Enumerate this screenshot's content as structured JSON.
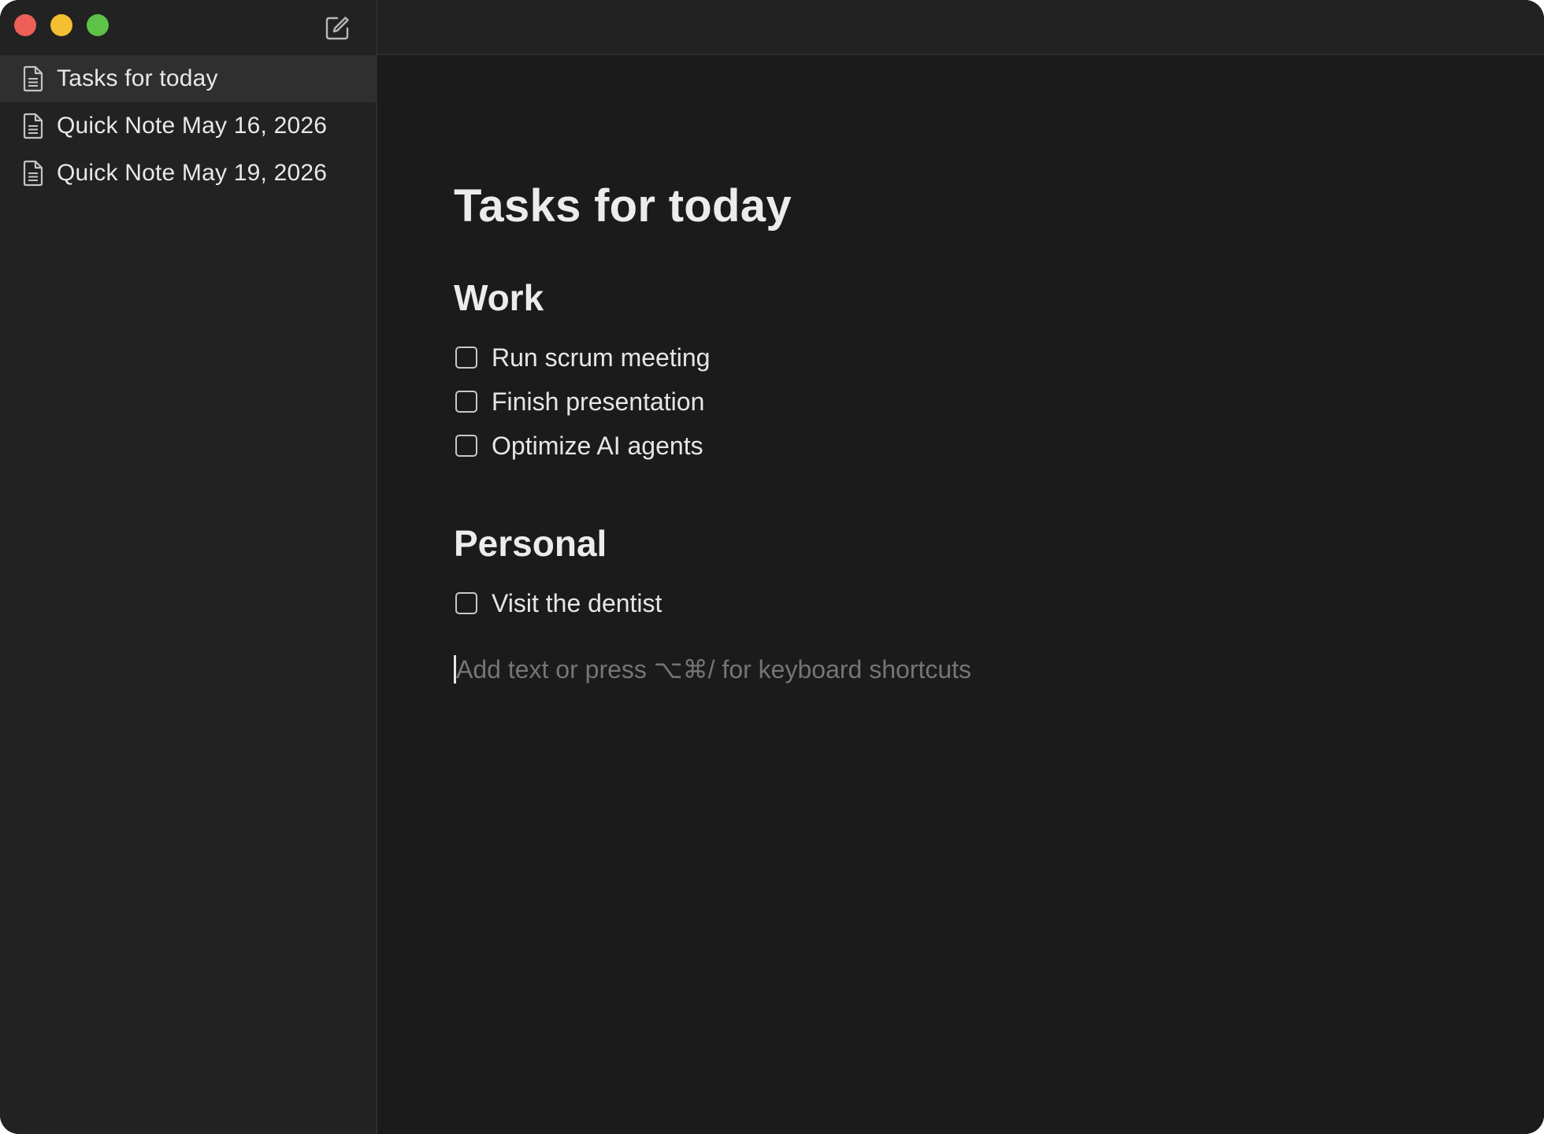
{
  "window": {
    "traffic_lights": [
      "close",
      "minimize",
      "zoom"
    ],
    "colors": {
      "close": "#ed5f57",
      "minimize": "#f4bf30",
      "zoom": "#5ec148",
      "background": "#1b1b1b",
      "sidebar": "#222222",
      "selected_row": "#2f2f2f"
    }
  },
  "sidebar": {
    "compose_icon": "compose-icon",
    "notes": [
      {
        "label": "Tasks for today",
        "icon": "document-icon",
        "selected": true
      },
      {
        "label": "Quick Note May 16, 2026",
        "icon": "document-icon",
        "selected": false
      },
      {
        "label": "Quick Note May 19, 2026",
        "icon": "document-icon",
        "selected": false
      }
    ]
  },
  "editor": {
    "title": "Tasks for today",
    "sections": [
      {
        "heading": "Work",
        "tasks": [
          {
            "text": "Run scrum meeting",
            "checked": false
          },
          {
            "text": "Finish presentation",
            "checked": false
          },
          {
            "text": "Optimize AI agents",
            "checked": false
          }
        ]
      },
      {
        "heading": "Personal",
        "tasks": [
          {
            "text": "Visit the dentist",
            "checked": false
          }
        ]
      }
    ],
    "placeholder": "Add text or press ⌥⌘/ for keyboard shortcuts"
  }
}
